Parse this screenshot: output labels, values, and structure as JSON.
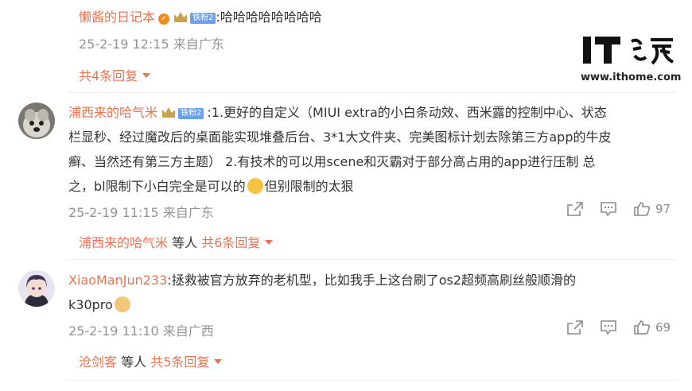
{
  "watermark": {
    "brand_text": "IT之家",
    "url": "www.ithome.com"
  },
  "comments": [
    {
      "username": "懒酱的日记本",
      "fan_badge": "铁粉2",
      "text": ":哈哈哈哈哈哈哈哈",
      "timestamp": "25-2-19 12:15 来自广东",
      "replies_link": "共4条回复"
    },
    {
      "username": "浦西来的哈气米",
      "fan_badge": "铁粉2",
      "text_lines": [
        ":1.更好的自定义（MIUI extra的小白条动效、西米露的控制中心、状态",
        "栏显秒、经过魔改后的桌面能实现堆叠后台、3*1大文件夹、完美图标计划去除第三方app的牛皮",
        "癣、当然还有第三方主题） 2.有技术的可以用scene和灭霸对于部分高占用的app进行压制 总",
        "之，bl限制下小白完全是可以的",
        "但别限制的太狠"
      ],
      "timestamp": "25-2-19 11:15 来自广东",
      "likes": "97",
      "replies": {
        "user": "浦西来的哈气米",
        "middle": " 等人 ",
        "count": "共6条回复"
      }
    },
    {
      "username": "XiaoManJun233",
      "text_lines": [
        ":拯救被官方放弃的老机型，比如我手上这台刷了os2超频高刷丝般顺滑的",
        "k30pro"
      ],
      "timestamp": "25-2-19 11:10 来自广西",
      "likes": "69",
      "replies": {
        "user": "沧剑客",
        "middle": " 等人 ",
        "count": "共5条回复"
      }
    }
  ],
  "icons": {
    "share": "share-icon",
    "comment": "comment-icon",
    "like": "thumbs-up-icon",
    "verified": "verified-icon",
    "crown": "crown-icon"
  },
  "colors": {
    "username": "#eb7350",
    "meta": "#939393",
    "badge": "#6d9ee8"
  }
}
